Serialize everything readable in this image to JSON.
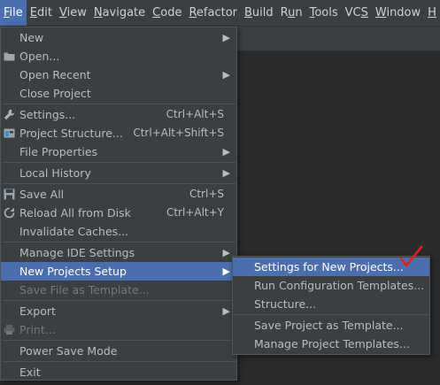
{
  "menubar": {
    "items": [
      {
        "label": "File",
        "mnemonic": "F",
        "rest": "ile",
        "active": true
      },
      {
        "label": "Edit",
        "mnemonic": "E",
        "rest": "dit"
      },
      {
        "label": "View",
        "mnemonic": "V",
        "rest": "iew"
      },
      {
        "label": "Navigate",
        "mnemonic": "N",
        "rest": "avigate"
      },
      {
        "label": "Code",
        "mnemonic": "C",
        "rest": "ode"
      },
      {
        "label": "Refactor",
        "mnemonic": "R",
        "rest": "efactor"
      },
      {
        "label": "Build",
        "mnemonic": "B",
        "rest": "uild"
      },
      {
        "label": "Run",
        "mnemonic": "u",
        "pre": "R",
        "rest": "n"
      },
      {
        "label": "Tools",
        "mnemonic": "T",
        "rest": "ools"
      },
      {
        "label": "VCS",
        "mnemonic": "S",
        "pre": "VC",
        "rest": ""
      },
      {
        "label": "Window",
        "mnemonic": "W",
        "rest": "indow"
      },
      {
        "label": "Help",
        "mnemonic": "H",
        "rest": ""
      }
    ]
  },
  "file_menu": {
    "new": "New",
    "open": "Open...",
    "open_recent": "Open Recent",
    "close_project": "Close Project",
    "settings": "Settings...",
    "settings_shortcut": "Ctrl+Alt+S",
    "project_structure": "Project Structure...",
    "project_structure_shortcut": "Ctrl+Alt+Shift+S",
    "file_properties": "File Properties",
    "local_history": "Local History",
    "save_all": "Save All",
    "save_all_shortcut": "Ctrl+S",
    "reload_all": "Reload All from Disk",
    "reload_all_shortcut": "Ctrl+Alt+Y",
    "invalidate_caches": "Invalidate Caches...",
    "manage_ide_settings": "Manage IDE Settings",
    "new_projects_setup": "New Projects Setup",
    "save_file_as_template": "Save File as Template...",
    "export": "Export",
    "print": "Print...",
    "power_save_mode": "Power Save Mode",
    "exit": "Exit"
  },
  "sub_menu": {
    "settings_for_new_projects": "Settings for New Projects...",
    "run_configuration_templates": "Run Configuration Templates...",
    "structure": "Structure...",
    "save_project_as_template": "Save Project as Template...",
    "manage_project_templates": "Manage Project Templates..."
  },
  "colors": {
    "selection": "#4b6eaf",
    "menu_bg": "#3c3f41",
    "checkmark": "#e0201c"
  }
}
